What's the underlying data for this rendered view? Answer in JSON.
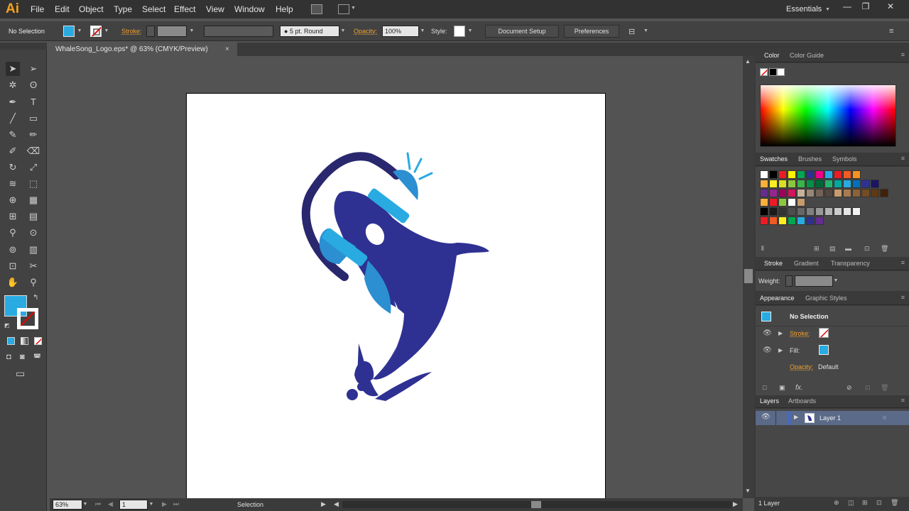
{
  "app": {
    "logo": "Ai",
    "workspace": "Essentials"
  },
  "menu": [
    "File",
    "Edit",
    "Object",
    "Type",
    "Select",
    "Effect",
    "View",
    "Window",
    "Help"
  ],
  "control": {
    "selection": "No Selection",
    "stroke_label": "Stroke:",
    "brush": "5 pt. Round",
    "opacity_label": "Opacity:",
    "opacity": "100%",
    "style_label": "Style:",
    "document_setup": "Document Setup",
    "preferences": "Preferences"
  },
  "document": {
    "tab": "WhaleSong_Logo.eps* @ 63% (CMYK/Preview)",
    "close": "×"
  },
  "status": {
    "zoom": "63%",
    "artboard": "1",
    "tool": "Selection"
  },
  "panels": {
    "color_tabs": [
      "Color",
      "Color Guide"
    ],
    "swatch_tabs": [
      "Swatches",
      "Brushes",
      "Symbols"
    ],
    "stroke_tabs": [
      "Stroke",
      "Gradient",
      "Transparency"
    ],
    "weight_label": "Weight:",
    "appearance_tabs": [
      "Appearance",
      "Graphic Styles"
    ],
    "appearance": {
      "title": "No Selection",
      "stroke": "Stroke:",
      "fill": "Fill:",
      "opacity": "Opacity:",
      "opacity_value": "Default",
      "fx": "fx."
    },
    "layers_tabs": [
      "Layers",
      "Artboards"
    ],
    "layer_name": "Layer 1",
    "layer_count": "1 Layer"
  },
  "colors": {
    "fill": "#29abe2",
    "whale_dark": "#2e3192",
    "headphone_band": "#29276e",
    "headphone_blue": "#2b8fd1",
    "headphone_light": "#29abe2",
    "accent_orange": "#f7a21b"
  },
  "swatches": [
    [
      "#ffffff",
      "#000000",
      "#ed1c24",
      "#fff200",
      "#00a651",
      "#2e3192",
      "#ec008c",
      "#29abe2",
      "#ed1c24",
      "#f15a24",
      "#f7931e"
    ],
    [
      "#fbb03b",
      "#fcee21",
      "#d9e021",
      "#8cc63f",
      "#39b54a",
      "#009245",
      "#006837",
      "#22b573",
      "#00a99d",
      "#29abe2",
      "#0071bc",
      "#2e3192",
      "#1b1464"
    ],
    [
      "#662d91",
      "#93278f",
      "#9e005d",
      "#d4145a",
      "#c7b299",
      "#998675",
      "#736357",
      "#534741",
      "#c69c6d",
      "#a67c52",
      "#8c6239",
      "#754c24",
      "#603813",
      "#42210b"
    ],
    [
      "#fbb03b",
      "#ed1c24",
      "#8cc63f",
      "#ffffff",
      "#c69c6d"
    ],
    [
      "#000000",
      "#1a1a1a",
      "#333333",
      "#4d4d4d",
      "#666666",
      "#808080",
      "#999999",
      "#b3b3b3",
      "#cccccc",
      "#e6e6e6",
      "#f2f2f2"
    ],
    [
      "#ed1c24",
      "#f15a24",
      "#fcee21",
      "#00a651",
      "#29abe2",
      "#2e3192",
      "#662d91"
    ]
  ]
}
